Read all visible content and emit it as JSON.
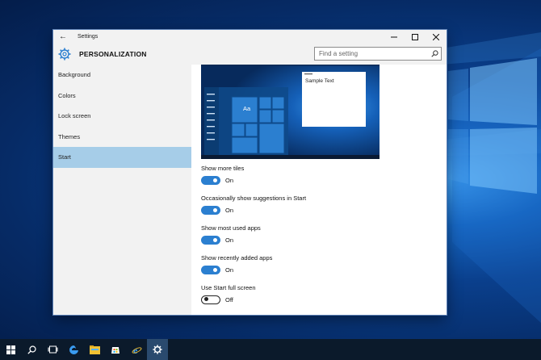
{
  "window": {
    "title": "Settings"
  },
  "header": {
    "title": "PERSONALIZATION",
    "search_placeholder": "Find a setting"
  },
  "sidebar": {
    "items": [
      {
        "label": "Background"
      },
      {
        "label": "Colors"
      },
      {
        "label": "Lock screen"
      },
      {
        "label": "Themes"
      },
      {
        "label": "Start"
      }
    ],
    "selected_index": 4
  },
  "preview": {
    "tile_text": "Aa",
    "sample_text": "Sample Text"
  },
  "settings": [
    {
      "label": "Show more tiles",
      "state": "On",
      "on": true
    },
    {
      "label": "Occasionally show suggestions in Start",
      "state": "On",
      "on": true
    },
    {
      "label": "Show most used apps",
      "state": "On",
      "on": true
    },
    {
      "label": "Show recently added apps",
      "state": "On",
      "on": true
    },
    {
      "label": "Use Start full screen",
      "state": "Off",
      "on": false
    }
  ],
  "colors": {
    "accent": "#2b7fd0",
    "selected_nav": "#a6cde8",
    "taskbar": "#0b1a2b"
  },
  "taskbar": {
    "icons": [
      "windows-start-icon",
      "search-icon",
      "task-view-icon",
      "edge-icon",
      "file-explorer-icon",
      "store-icon",
      "internet-explorer-icon",
      "settings-icon"
    ]
  }
}
